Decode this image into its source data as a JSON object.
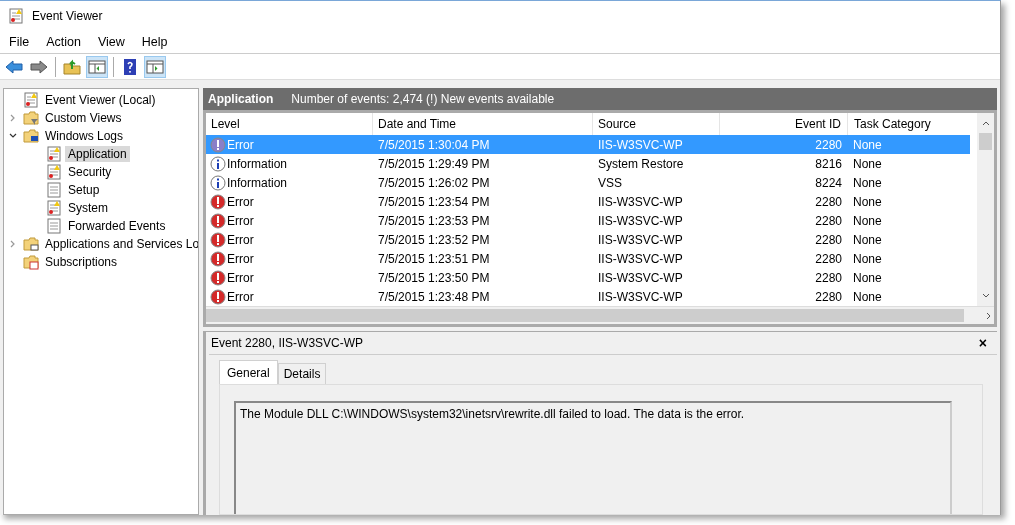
{
  "window": {
    "title": "Event Viewer"
  },
  "menu": [
    "File",
    "Action",
    "View",
    "Help"
  ],
  "toolbar": [
    {
      "kind": "back",
      "pressed": false
    },
    {
      "kind": "forward",
      "pressed": false
    },
    {
      "kind": "sep"
    },
    {
      "kind": "up",
      "pressed": false
    },
    {
      "kind": "pane",
      "pressed": true
    },
    {
      "kind": "sep"
    },
    {
      "kind": "help",
      "pressed": false
    },
    {
      "kind": "actionpane",
      "pressed": true
    }
  ],
  "tree": [
    {
      "label": "Event Viewer (Local)",
      "kind": "warnlog",
      "selected": false,
      "children": [
        {
          "label": "Custom Views",
          "kind": "filterfolder",
          "selected": false,
          "expanded": false
        },
        {
          "label": "Windows Logs",
          "kind": "pcfolder",
          "selected": false,
          "expanded": true,
          "children": [
            {
              "label": "Application",
              "kind": "warnlog",
              "selected": true
            },
            {
              "label": "Security",
              "kind": "warnlog",
              "selected": false
            },
            {
              "label": "Setup",
              "kind": "log",
              "selected": false
            },
            {
              "label": "System",
              "kind": "warnlog",
              "selected": false
            },
            {
              "label": "Forwarded Events",
              "kind": "log",
              "selected": false
            }
          ]
        },
        {
          "label": "Applications and Services Lo",
          "kind": "winfolder",
          "selected": false,
          "expanded": false
        },
        {
          "label": "Subscriptions",
          "kind": "calfolder",
          "selected": false
        }
      ]
    }
  ],
  "header": {
    "title": "Application",
    "info": "Number of events: 2,474 (!) New events available"
  },
  "table": {
    "columns": [
      "Level",
      "Date and Time",
      "Source",
      "Event ID",
      "Task Category"
    ],
    "rows": [
      {
        "kind": "error",
        "selected": true,
        "cells": [
          "Error",
          "7/5/2015 1:30:04 PM",
          "IIS-W3SVC-WP",
          "2280",
          "None"
        ]
      },
      {
        "kind": "information",
        "selected": false,
        "cells": [
          "Information",
          "7/5/2015 1:29:49 PM",
          "System Restore",
          "8216",
          "None"
        ]
      },
      {
        "kind": "information",
        "selected": false,
        "cells": [
          "Information",
          "7/5/2015 1:26:02 PM",
          "VSS",
          "8224",
          "None"
        ]
      },
      {
        "kind": "error",
        "selected": false,
        "cells": [
          "Error",
          "7/5/2015 1:23:54 PM",
          "IIS-W3SVC-WP",
          "2280",
          "None"
        ]
      },
      {
        "kind": "error",
        "selected": false,
        "cells": [
          "Error",
          "7/5/2015 1:23:53 PM",
          "IIS-W3SVC-WP",
          "2280",
          "None"
        ]
      },
      {
        "kind": "error",
        "selected": false,
        "cells": [
          "Error",
          "7/5/2015 1:23:52 PM",
          "IIS-W3SVC-WP",
          "2280",
          "None"
        ]
      },
      {
        "kind": "error",
        "selected": false,
        "cells": [
          "Error",
          "7/5/2015 1:23:51 PM",
          "IIS-W3SVC-WP",
          "2280",
          "None"
        ]
      },
      {
        "kind": "error",
        "selected": false,
        "cells": [
          "Error",
          "7/5/2015 1:23:50 PM",
          "IIS-W3SVC-WP",
          "2280",
          "None"
        ]
      },
      {
        "kind": "error",
        "selected": false,
        "cells": [
          "Error",
          "7/5/2015 1:23:48 PM",
          "IIS-W3SVC-WP",
          "2280",
          "None"
        ]
      }
    ]
  },
  "detail": {
    "title": "Event 2280, IIS-W3SVC-WP",
    "close": "×",
    "tabs": [
      {
        "label": "General",
        "selected": true
      },
      {
        "label": "Details",
        "selected": false
      }
    ],
    "message": "The Module DLL C:\\WINDOWS\\system32\\inetsrv\\rewrite.dll failed to load.  The data is the error."
  }
}
